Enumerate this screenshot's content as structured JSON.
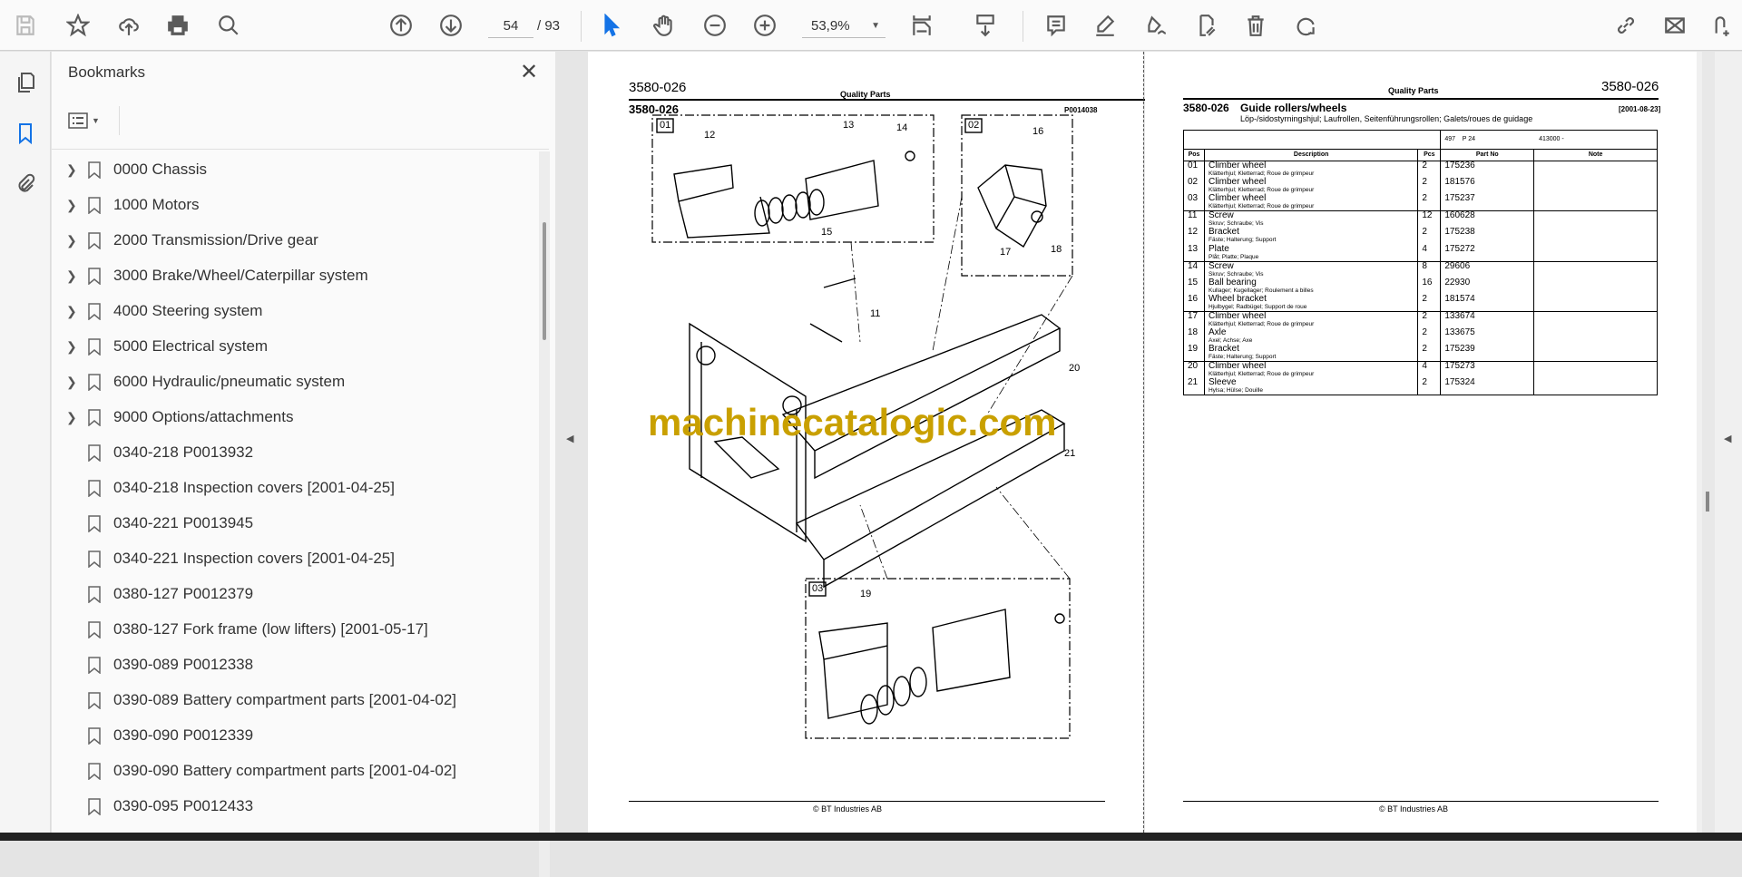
{
  "toolbar": {
    "page_current": "54",
    "page_total": "/ 93",
    "zoom": "53,9%"
  },
  "bookmarks": {
    "title": "Bookmarks",
    "items": [
      {
        "label": "0000 Chassis",
        "expandable": true
      },
      {
        "label": "1000 Motors",
        "expandable": true
      },
      {
        "label": "2000 Transmission/Drive gear",
        "expandable": true
      },
      {
        "label": "3000 Brake/Wheel/Caterpillar system",
        "expandable": true
      },
      {
        "label": "4000 Steering system",
        "expandable": true
      },
      {
        "label": "5000 Electrical system",
        "expandable": true
      },
      {
        "label": "6000 Hydraulic/pneumatic system",
        "expandable": true
      },
      {
        "label": "9000 Options/attachments",
        "expandable": true
      },
      {
        "label": "0340-218 P0013932",
        "expandable": false
      },
      {
        "label": "0340-218 Inspection covers [2001-04-25]",
        "expandable": false
      },
      {
        "label": "0340-221 P0013945",
        "expandable": false
      },
      {
        "label": "0340-221 Inspection covers [2001-04-25]",
        "expandable": false
      },
      {
        "label": "0380-127 P0012379",
        "expandable": false
      },
      {
        "label": "0380-127 Fork frame (low lifters) [2001-05-17]",
        "expandable": false
      },
      {
        "label": "0390-089 P0012338",
        "expandable": false
      },
      {
        "label": "0390-089 Battery compartment parts [2001-04-02]",
        "expandable": false
      },
      {
        "label": "0390-090 P0012339",
        "expandable": false
      },
      {
        "label": "0390-090 Battery compartment parts [2001-04-02]",
        "expandable": false
      },
      {
        "label": "0390-095 P0012433",
        "expandable": false
      }
    ]
  },
  "left_page": {
    "code": "3580-026",
    "header": "Quality Parts",
    "section": "3580-026",
    "drawing_no": "P0014038",
    "boxes": [
      "01",
      "02",
      "03"
    ],
    "callouts": [
      "12",
      "13",
      "14",
      "15",
      "16",
      "17",
      "18",
      "11",
      "20",
      "21",
      "19"
    ],
    "watermark": "machinecatalogic.com",
    "footer": "© BT Industries AB"
  },
  "right_page": {
    "header": "Quality Parts",
    "code": "3580-026",
    "section": "3580-026",
    "title": "Guide rollers/wheels",
    "date": "[2001-08-23]",
    "subtitle": "Löp-/sidostyrningshjul; Laufrollen, Seitenführungsrollen; Galets/roues de guidage",
    "model": "497    P 24",
    "serial": "413000 -",
    "columns": [
      "Pos",
      "Description",
      "Pcs",
      "Part No",
      "Note"
    ],
    "rows": [
      {
        "pos": "01",
        "desc": "Climber wheel",
        "sub": "Klätterhjul; Kletterrad; Roue de grimpeur",
        "pcs": "2",
        "part": "175236",
        "note": ""
      },
      {
        "pos": "02",
        "desc": "Climber wheel",
        "sub": "Klätterhjul; Kletterrad; Roue de grimpeur",
        "pcs": "2",
        "part": "181576",
        "note": ""
      },
      {
        "pos": "03",
        "desc": "Climber wheel",
        "sub": "Klätterhjul; Kletterrad; Roue de grimpeur",
        "pcs": "2",
        "part": "175237",
        "note": ""
      },
      {
        "pos": "11",
        "desc": "Screw",
        "sub": "Skruv; Schraube; Vis",
        "pcs": "12",
        "part": "160628",
        "note": ""
      },
      {
        "pos": "12",
        "desc": "Bracket",
        "sub": "Fäste; Halterung; Support",
        "pcs": "2",
        "part": "175238",
        "note": ""
      },
      {
        "pos": "13",
        "desc": "Plate",
        "sub": "Plåt; Platte; Plaque",
        "pcs": "4",
        "part": "175272",
        "note": ""
      },
      {
        "pos": "14",
        "desc": "Screw",
        "sub": "Skruv; Schraube; Vis",
        "pcs": "8",
        "part": "29606",
        "note": ""
      },
      {
        "pos": "15",
        "desc": "Ball bearing",
        "sub": "Kullager; Kugellager; Roulement a billes",
        "pcs": "16",
        "part": "22930",
        "note": ""
      },
      {
        "pos": "16",
        "desc": "Wheel bracket",
        "sub": "Hjulbygel; Radbügel; Support de roue",
        "pcs": "2",
        "part": "181574",
        "note": ""
      },
      {
        "pos": "17",
        "desc": "Climber wheel",
        "sub": "Klätterhjul; Kletterrad; Roue de grimpeur",
        "pcs": "2",
        "part": "133674",
        "note": ""
      },
      {
        "pos": "18",
        "desc": "Axle",
        "sub": "Axel; Achse; Axe",
        "pcs": "2",
        "part": "133675",
        "note": ""
      },
      {
        "pos": "19",
        "desc": "Bracket",
        "sub": "Fäste; Halterung; Support",
        "pcs": "2",
        "part": "175239",
        "note": ""
      },
      {
        "pos": "20",
        "desc": "Climber wheel",
        "sub": "Klätterhjul; Kletterrad; Roue de grimpeur",
        "pcs": "4",
        "part": "175273",
        "note": ""
      },
      {
        "pos": "21",
        "desc": "Sleeve",
        "sub": "Hylsa; Hülse; Douille",
        "pcs": "2",
        "part": "175324",
        "note": ""
      }
    ],
    "group_starts": [
      3,
      6,
      9,
      12
    ],
    "footer": "© BT Industries AB"
  },
  "colors": {
    "accent": "#1473e6",
    "watermark": "#c9a000"
  }
}
